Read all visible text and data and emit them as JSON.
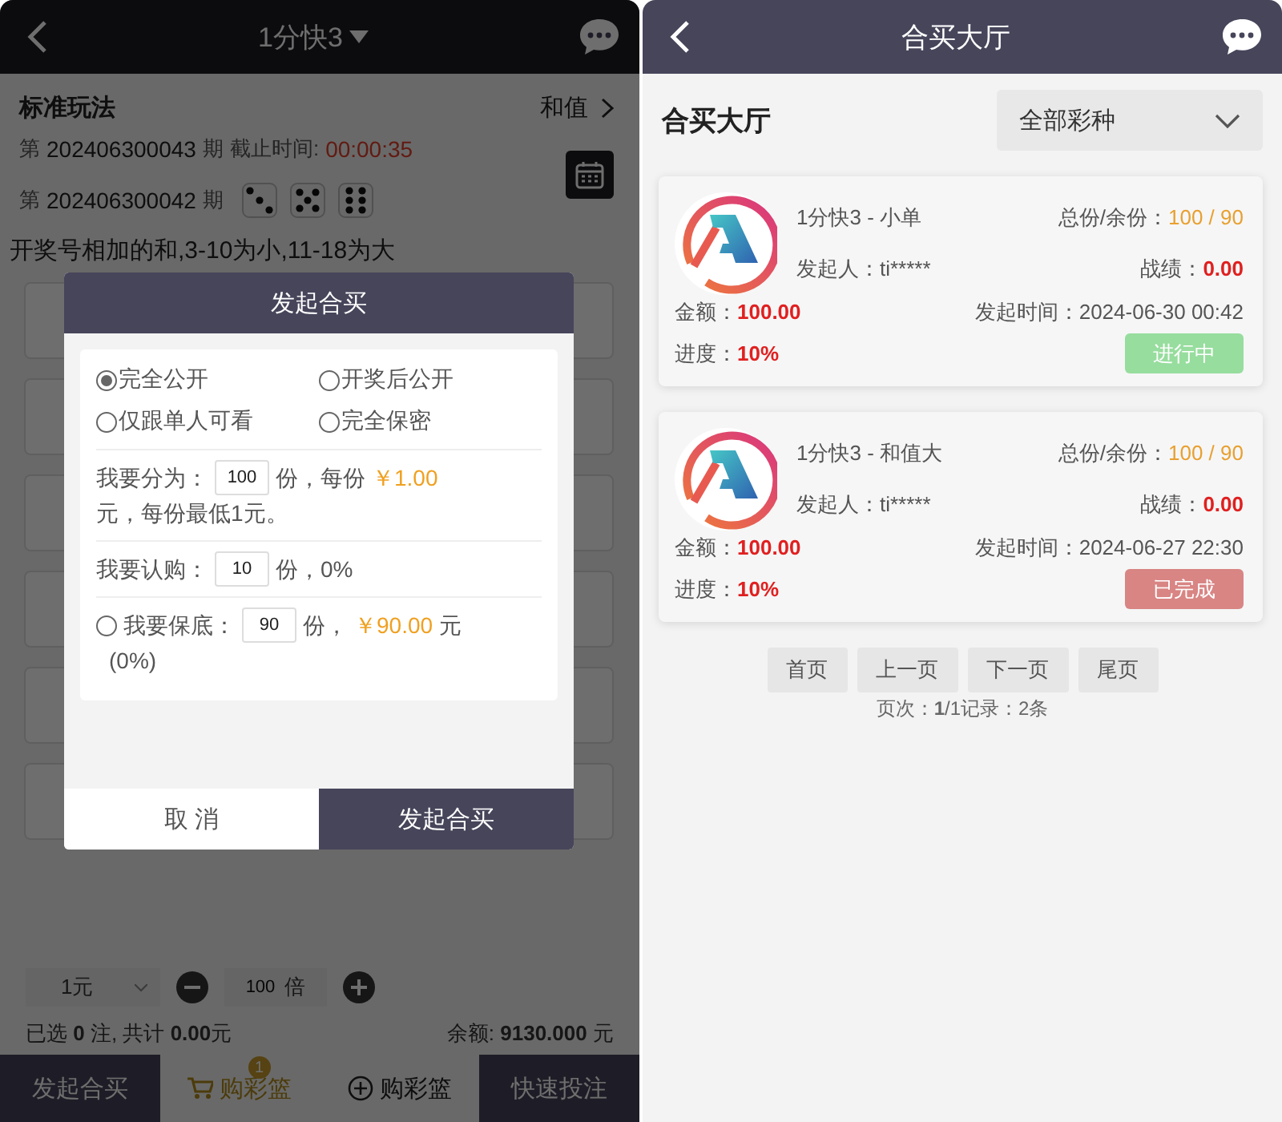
{
  "left": {
    "header": {
      "title": "1分快3"
    },
    "play": {
      "mode": "标准玩法",
      "type": "和值"
    },
    "current": {
      "prefix": "第",
      "issue": "202406300043",
      "suffix": "期",
      "deadline_label": "截止时间:",
      "countdown": "00:00:35"
    },
    "previous": {
      "prefix": "第",
      "issue": "202406300042",
      "suffix": "期",
      "dice": [
        {
          "kind": "three"
        },
        {
          "kind": "five"
        },
        {
          "kind": "six"
        }
      ]
    },
    "rule": "开奖号相加的和,3-10为小,11-18为大",
    "unit": "1元",
    "multiplier": {
      "value": "100",
      "unit": "倍"
    },
    "summary": "已选 **0** 注, 共计 **0.00**元",
    "balance": "余额: **9130.000** 元",
    "bottom_bar": [
      {
        "label": "发起合买",
        "kind": "dark"
      },
      {
        "label": "购彩篮",
        "kind": "cart",
        "badge": "1"
      },
      {
        "label": "购彩篮",
        "kind": "add"
      },
      {
        "label": "快速投注",
        "kind": "dark"
      }
    ],
    "dialog": {
      "title": "发起合买",
      "visibility": [
        {
          "label": "完全公开",
          "selected": true
        },
        {
          "label": "开奖后公开",
          "selected": false
        },
        {
          "label": "仅跟单人可看",
          "selected": false
        },
        {
          "label": "完全保密",
          "selected": false
        }
      ],
      "split": {
        "label": "我要分为：",
        "value": "100",
        "unit": "份，每份",
        "price": "￥1.00",
        "rest": "元，每份最低1元。"
      },
      "subscribe": {
        "label": "我要认购：",
        "value": "10",
        "rest": "份，0%"
      },
      "guarantee": {
        "checked": false,
        "label": "我要保底：",
        "value": "90",
        "unit": "份，",
        "amount": "￥90.00",
        "rest": "元",
        "percent": "(0%)"
      },
      "cancel": "取 消",
      "confirm": "发起合买"
    }
  },
  "right": {
    "header": {
      "title": "合买大厅"
    },
    "heading": "合买大厅",
    "filter": "全部彩种",
    "orders": [
      {
        "name": "1分快3 - 小单",
        "shares_label": "总份/余份：",
        "shares": "100 / 90",
        "initiator_label": "发起人：",
        "initiator": "ti*****",
        "record_label": "战绩：",
        "record": "0.00",
        "amount_label": "金额：",
        "amount": "100.00",
        "time_label": "发起时间：",
        "time": "2024-06-30 00:42",
        "progress_label": "进度：",
        "progress": "10%",
        "status": {
          "kind": "ongoing",
          "label": "进行中"
        }
      },
      {
        "name": "1分快3 - 和值大",
        "shares_label": "总份/余份：",
        "shares": "100 / 90",
        "initiator_label": "发起人：",
        "initiator": "ti*****",
        "record_label": "战绩：",
        "record": "0.00",
        "amount_label": "金额：",
        "amount": "100.00",
        "time_label": "发起时间：",
        "time": "2024-06-27 22:30",
        "progress_label": "进度：",
        "progress": "10%",
        "status": {
          "kind": "done",
          "label": "已完成"
        }
      }
    ],
    "pagination": [
      "首页",
      "上一页",
      "下一页",
      "尾页"
    ],
    "page_info": "页次：**1**/1记录：2条"
  }
}
